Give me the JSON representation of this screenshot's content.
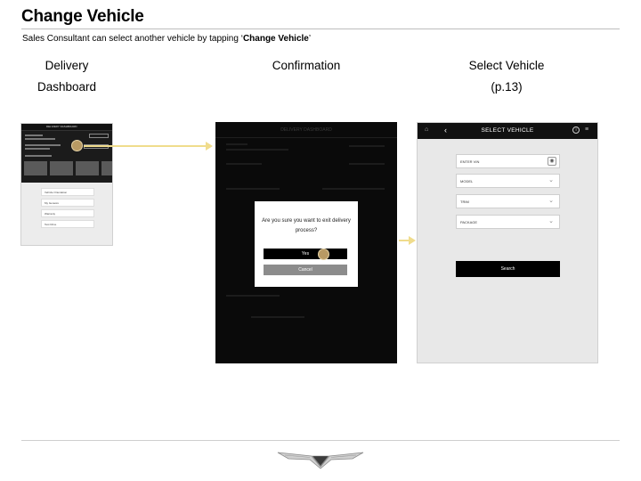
{
  "header": {
    "title": "Change Vehicle",
    "subtitle_prefix": "Sales Consultant can select another vehicle by tapping ‘",
    "subtitle_bold": "Change Vehicle",
    "subtitle_suffix": "’"
  },
  "columns": [
    {
      "line1": "Delivery",
      "line2": "Dashboard"
    },
    {
      "line1": "Confirmation",
      "line2": ""
    },
    {
      "line1": "Select Vehicle",
      "line2": "(p.13)"
    }
  ],
  "screen_dashboard": {
    "nav_title": "DELIVERY DASHBOARD",
    "cards": [
      "Vehicle Orientation",
      "My Genesis",
      "Warranty",
      "Test Drive"
    ]
  },
  "screen_confirm": {
    "header_title": "DELIVERY DASHBOARD",
    "question": "Are you sure you want to exit delivery process?",
    "yes_label": "Yes",
    "cancel_label": "Cancel"
  },
  "screen_select": {
    "title": "SELECT VEHICLE",
    "fields": [
      {
        "label": "ENTER VIN",
        "icon": "camera-icon"
      },
      {
        "label": "MODEL",
        "icon": "chevron-down-icon"
      },
      {
        "label": "TRIM",
        "icon": "chevron-down-icon"
      },
      {
        "label": "PACKAGE",
        "icon": "chevron-down-icon"
      }
    ],
    "search_label": "Search"
  },
  "colors": {
    "tap_indicator": "#b89a64",
    "flow_arrow": "#f0dc8c"
  }
}
